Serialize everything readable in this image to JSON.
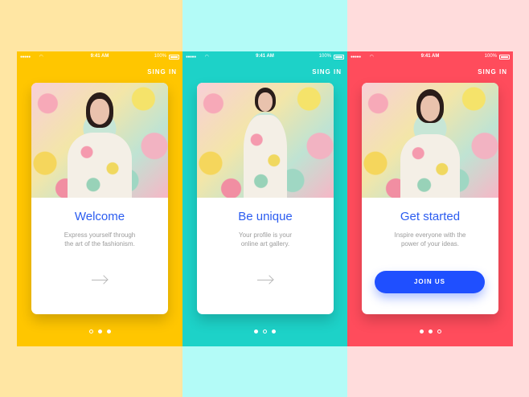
{
  "colors": {
    "bg_yellow": "#ffe6a3",
    "bg_cyan": "#b3fbf7",
    "bg_pink": "#ffdcdc",
    "screen_yellow": "#ffc600",
    "screen_teal": "#1dd2c8",
    "screen_red": "#ff4c5c",
    "accent_blue": "#2b5cf0",
    "button_blue": "#1f4fff"
  },
  "status_bar": {
    "signal": "●●●●●",
    "wifi_icon": "wifi-icon",
    "time": "9:41 AM",
    "battery_pct": "100%"
  },
  "screens": [
    {
      "signin": "SING IN",
      "title": "Welcome",
      "description": "Express yourself through\nthe art of the fashionism.",
      "next_icon": "arrow-right-icon",
      "pager": {
        "total": 3,
        "active": 1
      }
    },
    {
      "signin": "SING IN",
      "title": "Be unique",
      "description": "Your profile is your\nonline art gallery.",
      "next_icon": "arrow-right-icon",
      "pager": {
        "total": 3,
        "active": 2
      }
    },
    {
      "signin": "SING IN",
      "title": "Get started",
      "description": "Inspire everyone with the\npower of your ideas.",
      "button": "JOIN US",
      "pager": {
        "total": 3,
        "active": 3
      }
    }
  ]
}
